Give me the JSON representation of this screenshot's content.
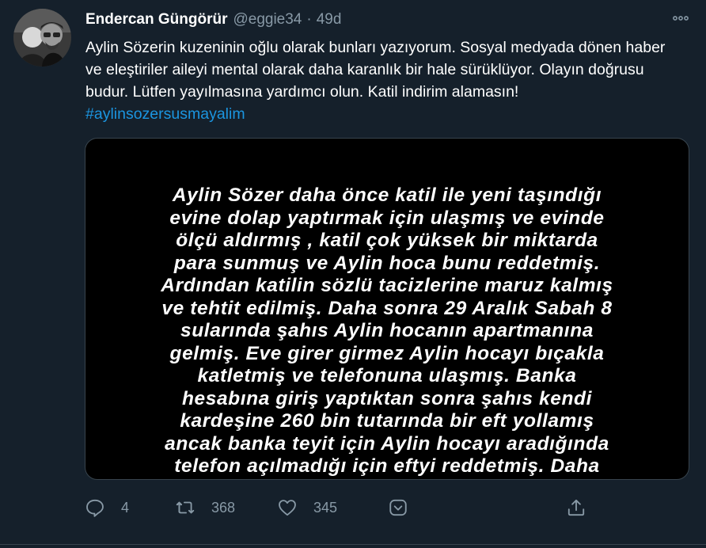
{
  "tweet": {
    "author_name": "Endercan Güngörür",
    "handle": "@eggie34",
    "separator": "·",
    "time": "49d",
    "more_icon": "more-horizontal-icon",
    "text_plain": "Aylin Sözerin kuzeninin oğlu olarak bunları yazıyorum. Sosyal medyada dönen haber ve eleştiriler aileyi mental olarak daha karanlık bir hale sürüklüyor. Olayın doğrusu budur. Lütfen yayılmasına yardımcı olun. Katil indirim alamasın!",
    "hashtag": "#aylinsozersusmayalim",
    "image_lines": [
      "Aylin Sözer daha önce katil ile yeni taşındığı",
      "evine dolap yaptırmak için ulaşmış ve evinde",
      "ölçü aldırmış , katil çok yüksek bir miktarda",
      "para sunmuş ve Aylin hoca bunu reddetmiş.",
      "Ardından katilin sözlü tacizlerine maruz kalmış",
      "ve tehtit edilmiş. Daha sonra 29 Aralık Sabah 8",
      "sularında şahıs Aylin hocanın apartmanına",
      "gelmiş. Eve girer girmez Aylin hocayı bıçakla",
      "katletmiş ve telefonuna ulaşmış. Banka",
      "hesabına giriş yaptıktan sonra şahıs kendi",
      "kardeşine 260 bin tutarında bir eft yollamış",
      "ancak banka teyit için Aylin hocayı aradığında",
      "telefon açılmadığı için eftyi reddetmiş. Daha"
    ],
    "actions": {
      "reply_count": "4",
      "retweet_count": "368",
      "like_count": "345"
    }
  },
  "colors": {
    "background": "#15202b",
    "secondary_text": "#8899a6",
    "link": "#1b95e0",
    "border": "#38444d"
  }
}
